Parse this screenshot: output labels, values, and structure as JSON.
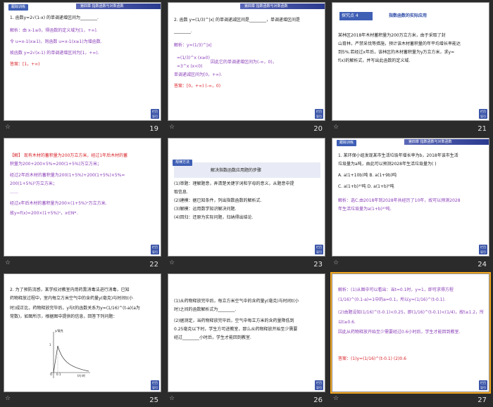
{
  "chapter_band": "第四章 指数函数与对数函数",
  "slides": [
    {
      "number": "19",
      "tab": "跟踪训练",
      "lines": [
        "1. 函数y=2√(1-x) 的单调递增区间为________.",
        "解析：由 x-1≥0，得函数的定义域为[1，+∞).",
        "令 u=x-1(x≥1)，则函数 u=x-1(x≥1)为增函数.",
        "故函数 y=2√(x-1) 的单调递增区间为[1，+∞).",
        "答案：[1，+∞)"
      ]
    },
    {
      "number": "20",
      "lines": [
        "2. 函数 y=(1/3)^|x| 的单调递减区间是________，单调递增区间是",
        "________.",
        "解析：y=(1/3)^|x|",
        "=(1/3)^x (x≥0)",
        "=3^x (x<0)",
        "因此它的单调递增区间为(-∞，0)，",
        "单调递减区间为[0，+∞).",
        "答案：[0，+∞)  (-∞，0)"
      ]
    },
    {
      "number": "21",
      "header": "探究点 4",
      "title": "指数函数的实际应用",
      "lines": [
        "某林区2018年木材蓄积量为200万立方米，由于采取了封",
        "山育林，严禁采伐等措施，预计该木材蓄积量的年平均增长率能达",
        "到5%.若经过x年后，该林区的木材蓄积量为y万立方米，求y=",
        "f(x)的解析式，并写出此函数的定义域."
      ]
    },
    {
      "number": "22",
      "lines": [
        "【解】 现有木材的蓄积量为200万立方米，经过1年后木材的蓄",
        "积量为200+200×5%=200(1+5%)万立方米；",
        "经过2年后木材的蓄积量为200(1+5%)+200(1+5%)×5%=",
        "200(1+5%)²万立方米；",
        "……",
        "经过x年后木材的蓄积量为200×(1+5%)ˣ万立方米.",
        "故y=f(x)=200×(1+5%)ˣ，x∈N*."
      ]
    },
    {
      "number": "23",
      "tab": "规律方法",
      "title": "解决指数函数应用题的步骤",
      "lines": [
        "(1)审题：理解题意，弄清楚关键字词和字母的意义，从题意中提",
        "取信息.",
        "(2)建模：据已知条件，列出指数函数的解析式.",
        "(3)解模：运用数学知识解决问题.",
        "(4)回归：还原为实际问题，归纳得出结论."
      ]
    },
    {
      "number": "24",
      "tab": "跟踪训练",
      "lines": [
        "1. 某环保小组发现某市生活垃圾年增长率为b，2018年该市生活",
        "垃圾量为a吨，由此可以预测2028年生活垃圾量为(    )",
        "A. a(1+10b)吨        B. a(1+9b)吨",
        "C. a(1+b)¹⁰吨        D. a(1+b)⁹吨",
        "解析：选C.由2018年到2028年共经历了10年，故可以预测2028",
        "年生活垃圾量为a(1+b)¹⁰吨."
      ]
    },
    {
      "number": "25",
      "lines": [
        "2. 为了预防流感，某学校对教室内用药熏消毒法进行消毒，已知",
        "药物释放过程中，室内每立方米空气中的含药量y(毫克)与时间t(小",
        "时)成正比，药物释放完毕后，y与t的函数关系为y=(1/16)^(t-a)(a为",
        "常数)，如图所示，根据图中提供的信息，回答下列问题："
      ],
      "chart": {
        "ylabel": "y/毫克",
        "xlabel": "t/小时",
        "origin": "O",
        "tick": "0.1",
        "ytick": "1"
      }
    },
    {
      "number": "26",
      "lines": [
        "(1)从药物释放完毕后，每立方米空气中的含药量y(毫克)与时间t(小",
        "时)之间的函数解析式为________.",
        "(2)据测定，当药物释放完毕后，空气中每立方米的含药量降低到",
        "0.25毫克以下时，学生方可进教室，那么从药物释放开始至少需要",
        "经过________小时后，学生才能回到教室."
      ]
    },
    {
      "number": "27",
      "lines": [
        "解析：(1)从图中可以看出：当t=0.1时，y=1，即可求得方程",
        "(1/16)^(0.1-a)=1中的a=0.1，所以y=(1/16)^(t-0.1).",
        "(2)由题设知(1/16)^(t-0.1)<0.25，即(1/16)^(t-0.1)<(1/4)，故t≥1.2，所",
        "以t≥0.6.",
        "因此从药物释放开始至少需要经过0.6小时后，学生才能回到教室.",
        "答案：(1)y=(1/16)^(t-0.1)   (2)0.6"
      ]
    }
  ]
}
